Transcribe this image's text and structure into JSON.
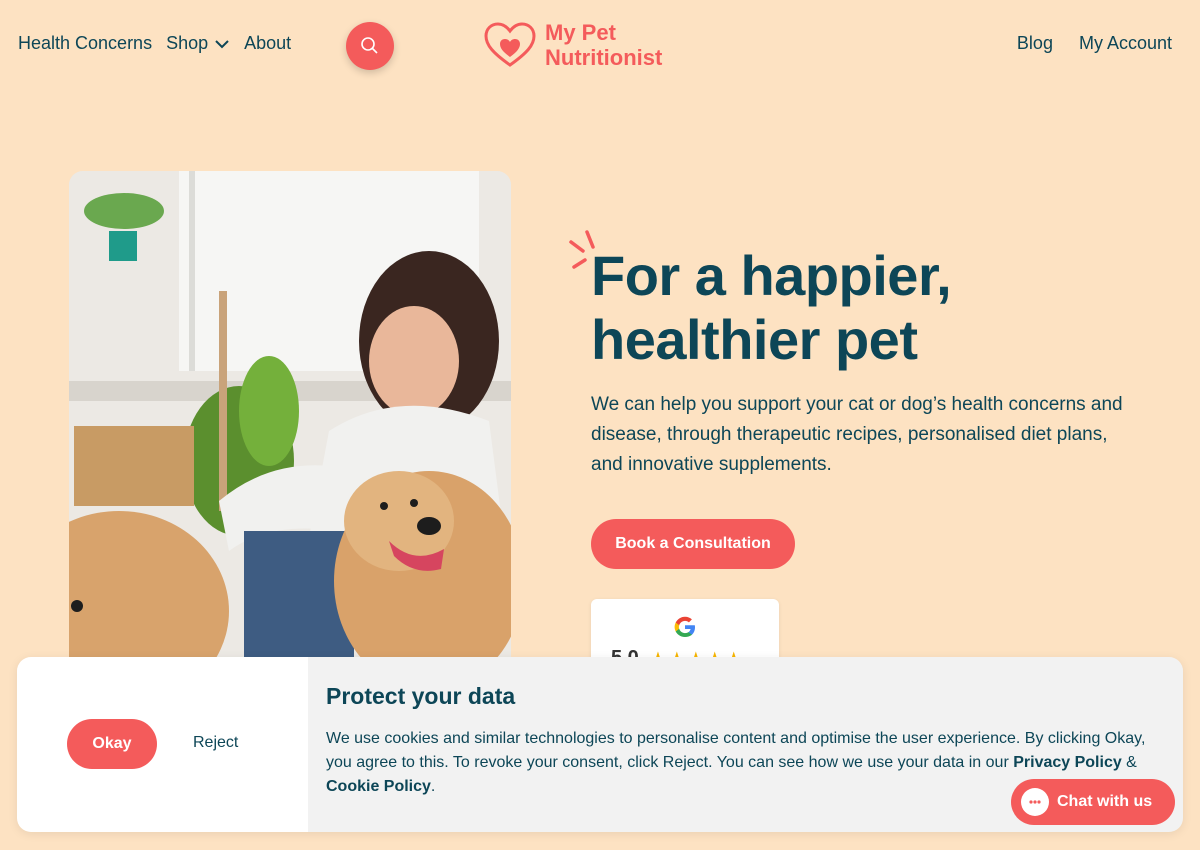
{
  "header": {
    "nav_left": [
      "Health Concerns",
      "Shop",
      "About"
    ],
    "logo_line1": "My Pet",
    "logo_line2": "Nutritionist",
    "nav_right": [
      "Blog",
      "My Account"
    ]
  },
  "hero": {
    "headline_line1": "For a happier,",
    "headline_line2": "healthier pet",
    "subtext": "We can help you support your cat or dog’s health concerns and disease, through therapeutic recipes, personalised diet plans, and innovative supplements.",
    "cta_label": "Book a Consultation",
    "review_score": "5.0",
    "review_stars": "★★★★★"
  },
  "cookie": {
    "okay_label": "Okay",
    "reject_label": "Reject",
    "title": "Protect your data",
    "text_part1": "We use cookies and similar technologies to personalise content and optimise the user experience. By clicking Okay, you agree to this. To revoke your consent, click Reject. You can see how we use your data in our ",
    "privacy_link": "Privacy Policy",
    "and": " & ",
    "cookie_link": "Cookie Policy",
    "end": "."
  },
  "chat": {
    "label": "Chat with us"
  },
  "colors": {
    "background": "#fde2c2",
    "accent": "#f45b5b",
    "text": "#0d4657"
  },
  "icons": [
    "search-icon",
    "chevron-down-icon",
    "heart-logo-icon",
    "sparkle-icon",
    "google-icon",
    "chat-bubble-icon"
  ]
}
